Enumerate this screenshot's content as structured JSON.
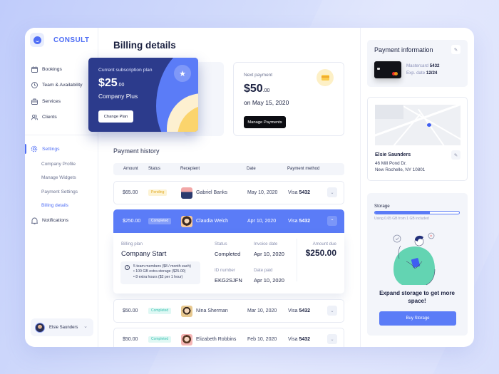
{
  "app": {
    "name": "CONSULT",
    "logo_icon": "smile-logo-icon"
  },
  "sidebar": {
    "items": [
      {
        "label": "Bookings",
        "icon": "calendar-icon"
      },
      {
        "label": "Team & Availability",
        "icon": "clock-icon"
      },
      {
        "label": "Services",
        "icon": "briefcase-icon"
      },
      {
        "label": "Clients",
        "icon": "users-icon"
      }
    ],
    "settings": {
      "label": "Settings",
      "icon": "gear-icon",
      "active": true
    },
    "settings_sub": [
      {
        "label": "Company Profile",
        "active": false
      },
      {
        "label": "Manage Widgets",
        "active": false
      },
      {
        "label": "Payment Settings",
        "active": false
      },
      {
        "label": "Billing details",
        "active": true
      }
    ],
    "notifications": {
      "label": "Notifications",
      "icon": "bell-icon"
    },
    "user": {
      "name": "Elsie Saunders"
    }
  },
  "main": {
    "title": "Billing details",
    "subscription": {
      "label": "Current subscription plan",
      "amount": "$25",
      "cents": ".00",
      "plan": "Company Plus",
      "button": "Change Plan"
    },
    "next_payment": {
      "label": "Next payment",
      "amount": "$50",
      "cents": ".00",
      "date": "on May 15, 2020",
      "button": "Manage Payments"
    },
    "history": {
      "title": "Payment history",
      "columns": [
        "Amount",
        "Status",
        "Recepient",
        "Date",
        "Payment method"
      ],
      "rows": [
        {
          "amount": "$65.00",
          "status": "Pending",
          "recipient": "Gabriel Banks",
          "date": "May 10, 2020",
          "method": "Visa",
          "last4": "5432",
          "expanded": false
        },
        {
          "amount": "$250.00",
          "status": "Completed",
          "recipient": "Claudia Welch",
          "date": "Apr 10, 2020",
          "method": "Visa",
          "last4": "5432",
          "expanded": true
        },
        {
          "amount": "$50.00",
          "status": "Completed",
          "recipient": "Nina Sherman",
          "date": "Mar 10, 2020",
          "method": "Visa",
          "last4": "5432",
          "expanded": false
        },
        {
          "amount": "$50.00",
          "status": "Completed",
          "recipient": "Elizabeth Robbins",
          "date": "Feb 10, 2020",
          "method": "Visa",
          "last4": "5432",
          "expanded": false
        }
      ],
      "detail": {
        "plan_label": "Billing plan",
        "plan": "Company Start",
        "info": [
          "5 team members ($8 / month each)",
          "• 100 GB extra storage ($25.00)",
          "• 8 extra hours ($2 per 1 hour)"
        ],
        "status_label": "Status",
        "status": "Completed",
        "invoice_label": "Invoice date",
        "invoice_date": "Apr 10, 2020",
        "id_label": "ID number",
        "id": "EKG2SJFN",
        "paid_label": "Date paid",
        "paid_date": "Apr 10, 2020",
        "due_label": "Amount due",
        "due": "$250.00"
      }
    }
  },
  "right": {
    "payment_info": {
      "title": "Payment information",
      "card_brand": "Mastercard",
      "card_last4": "5432",
      "exp_label": "Exp. date",
      "exp": "12/24"
    },
    "address": {
      "name": "Elsie Saunders",
      "line1": "46 Mill Pond Dr.",
      "line2": "New Rochelle, NY 10801"
    },
    "storage": {
      "title": "Storage",
      "used_fraction": 0.65,
      "note": "Using 0.65 GB from 1 GB included",
      "headline": "Expand storage to get more space!",
      "button": "Buy Storage"
    }
  },
  "colors": {
    "accent": "#5b7cf7",
    "navy": "#2c3b8c",
    "pending": "#e0a820",
    "completed": "#3cc2b2"
  }
}
